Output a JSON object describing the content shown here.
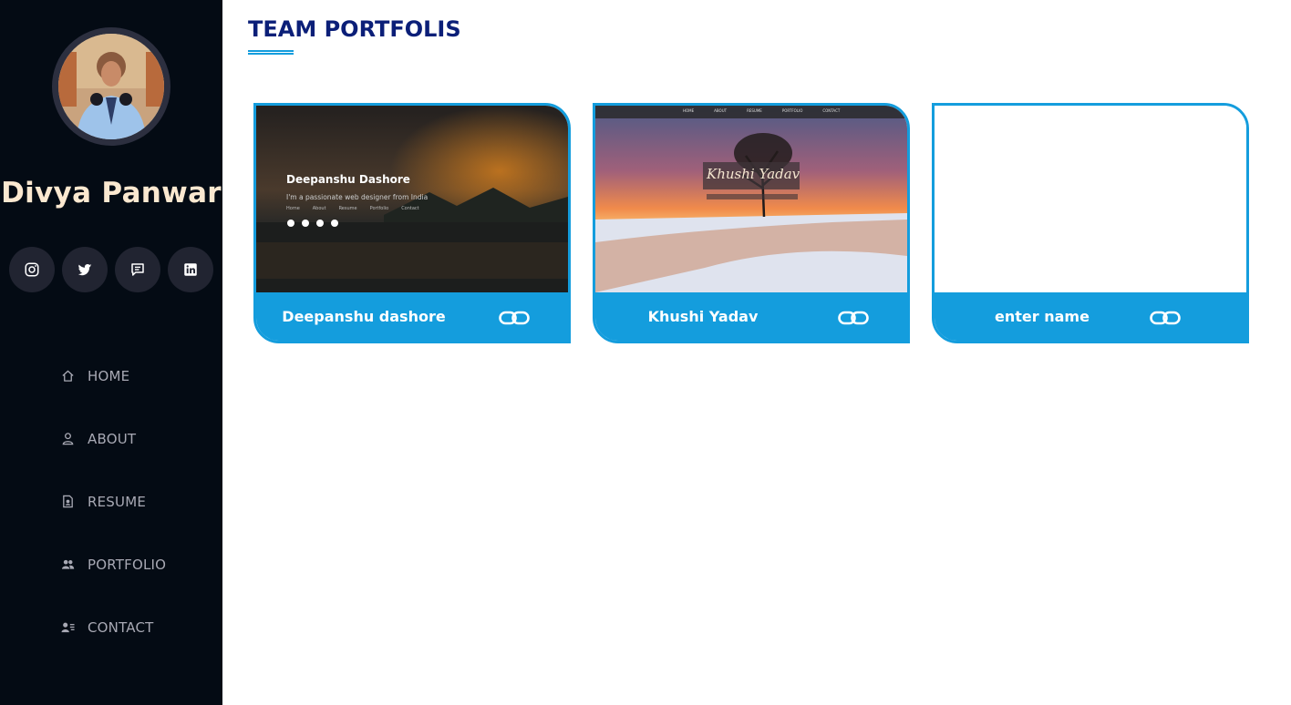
{
  "profile": {
    "name": "Divya Panwar"
  },
  "social": [
    {
      "icon": "instagram-icon"
    },
    {
      "icon": "twitter-icon"
    },
    {
      "icon": "chat-icon"
    },
    {
      "icon": "linkedin-icon"
    }
  ],
  "nav": [
    {
      "label": "HOME",
      "icon": "home-icon"
    },
    {
      "label": "ABOUT",
      "icon": "user-icon"
    },
    {
      "label": "RESUME",
      "icon": "resume-icon"
    },
    {
      "label": "PORTFOLIO",
      "icon": "team-icon"
    },
    {
      "label": "CONTACT",
      "icon": "contact-icon"
    }
  ],
  "section": {
    "title": "TEAM PORTFOLIS"
  },
  "portfolios": [
    {
      "name": "Deepanshu dashore",
      "preview": {
        "heading": "Deepanshu Dashore",
        "tagline": "I'm a passionate web designer from India",
        "menu": [
          "Home",
          "About",
          "Resume",
          "Portfolio",
          "Contact"
        ]
      }
    },
    {
      "name": "Khushi Yadav",
      "preview": {
        "heading": "Khushi Yadav",
        "menu": [
          "HOME",
          "ABOUT",
          "RESUME",
          "PORTFOLIO",
          "CONTACT"
        ]
      }
    },
    {
      "name": "enter name"
    }
  ],
  "colors": {
    "sidebar_bg": "#040b14",
    "accent": "#149ddd",
    "title": "#0b1f78",
    "name": "#fbe8d0"
  }
}
